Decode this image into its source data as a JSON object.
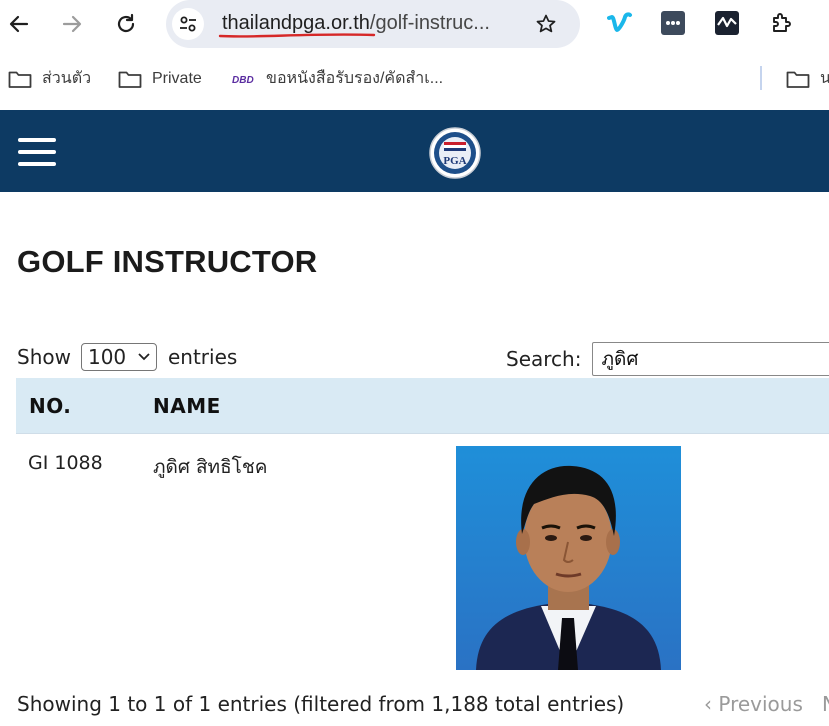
{
  "browser": {
    "url_host": "thailandpga.or.th",
    "url_path": "/golf-instruc...",
    "bookmarks": [
      {
        "label": "ส่วนตัว",
        "icon": "folder-icon"
      },
      {
        "label": "Private",
        "icon": "folder-icon"
      },
      {
        "label": "ขอหนังสือรับรอง/คัดสำเ...",
        "icon": "dbd-icon"
      },
      {
        "label": "น",
        "icon": "folder-icon"
      }
    ],
    "colors": {
      "vimeo": "#1ab7ea",
      "underline": "#d62828"
    }
  },
  "site": {
    "header_color": "#0d3a63",
    "logo_text": "PGA",
    "logo_top_text": "THAILAND"
  },
  "page": {
    "title": "GOLF INSTRUCTOR",
    "show_label": "Show",
    "entries_label": "entries",
    "page_size": "100",
    "search_label": "Search:",
    "search_value": "ภูดิศ"
  },
  "table": {
    "headers": {
      "no": "NO.",
      "name": "NAME"
    },
    "header_bg": "#d9eaf4",
    "rows": [
      {
        "no": "GI 1088",
        "name": "ภูดิศ สิทธิโชค"
      }
    ]
  },
  "footer": {
    "info": "Showing 1 to 1 of 1 entries (filtered from 1,188 total entries)",
    "previous": "Previous",
    "next": "N"
  }
}
